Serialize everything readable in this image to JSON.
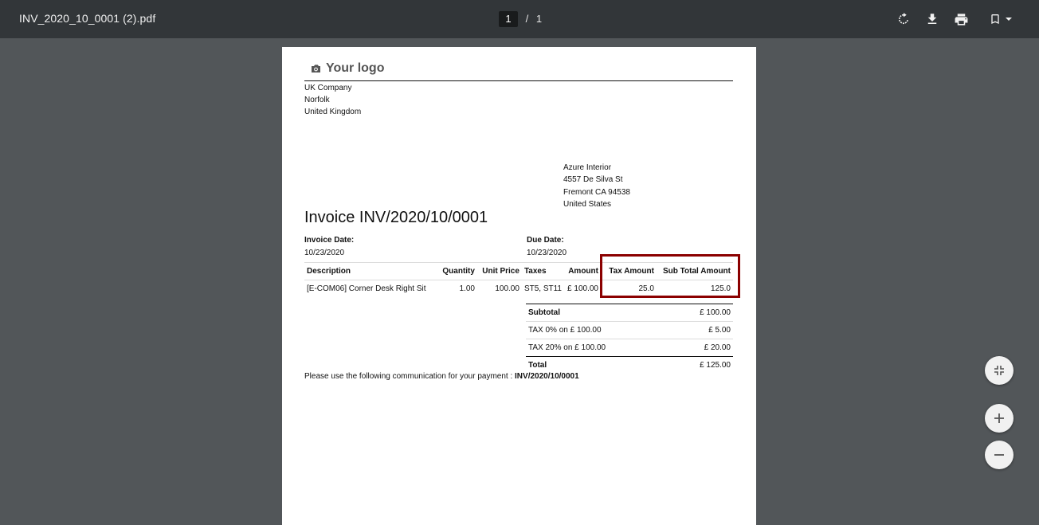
{
  "toolbar": {
    "file_name": "INV_2020_10_0001 (2).pdf",
    "current_page": "1",
    "separator": "/",
    "total_pages": "1",
    "icons": [
      "rotate-icon",
      "download-icon",
      "print-icon",
      "bookmark-icon",
      "caret-down-icon"
    ]
  },
  "document": {
    "logo_text": "Your logo",
    "company": {
      "name": "UK Company",
      "city": "Norfolk",
      "country": "United Kingdom"
    },
    "partner": {
      "name": "Azure Interior",
      "street": "4557 De Silva St",
      "city": "Fremont CA 94538",
      "country": "United States"
    },
    "title": "Invoice INV/2020/10/0001",
    "invoice_date_label": "Invoice Date:",
    "invoice_date": "10/23/2020",
    "due_date_label": "Due Date:",
    "due_date": "10/23/2020",
    "lines": {
      "headers": [
        "Description",
        "Quantity",
        "Unit Price",
        "Taxes",
        "Amount",
        "Tax Amount",
        "Sub Total Amount"
      ],
      "rows": [
        [
          "[E-COM06] Corner Desk Right Sit",
          "1.00",
          "100.00",
          "ST5, ST11",
          "£ 100.00",
          "25.0",
          "125.0"
        ]
      ]
    },
    "totals": {
      "subtotal_label": "Subtotal",
      "subtotal_value": "£ 100.00",
      "tax1_label": "TAX 0% on £ 100.00",
      "tax1_value": "£ 5.00",
      "tax2_label": "TAX 20% on £ 100.00",
      "tax2_value": "£ 20.00",
      "total_label": "Total",
      "total_value": "£ 125.00"
    },
    "communication_text": "Please use the following communication for your payment : ",
    "communication_ref": "INV/2020/10/0001"
  },
  "colors": {
    "toolbar_bg": "#323639",
    "viewer_bg": "#525659",
    "highlight_border": "#8b0000"
  },
  "zoom_controls": [
    "fit-page-icon",
    "zoom-in-icon",
    "zoom-out-icon"
  ]
}
